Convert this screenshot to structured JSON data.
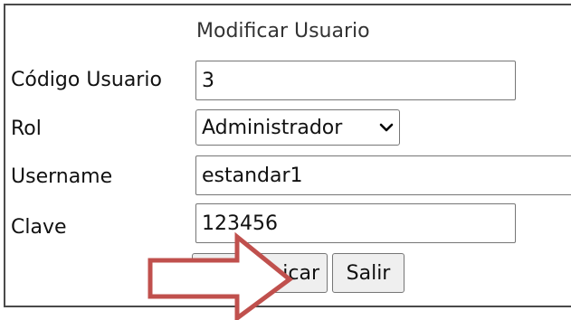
{
  "form": {
    "title": "Modificar Usuario",
    "fields": {
      "codigo_usuario": {
        "label": "Código Usuario",
        "value": "3"
      },
      "rol": {
        "label": "Rol",
        "selected": "Administrador"
      },
      "username": {
        "label": "Username",
        "value": "estandar1"
      },
      "clave": {
        "label": "Clave",
        "value": "123456"
      }
    },
    "buttons": {
      "modificar_visible": "icar",
      "salir": "Salir"
    }
  },
  "annotation": {
    "arrow_color": "#c0504d",
    "arrow_fill": "#ffffff"
  }
}
